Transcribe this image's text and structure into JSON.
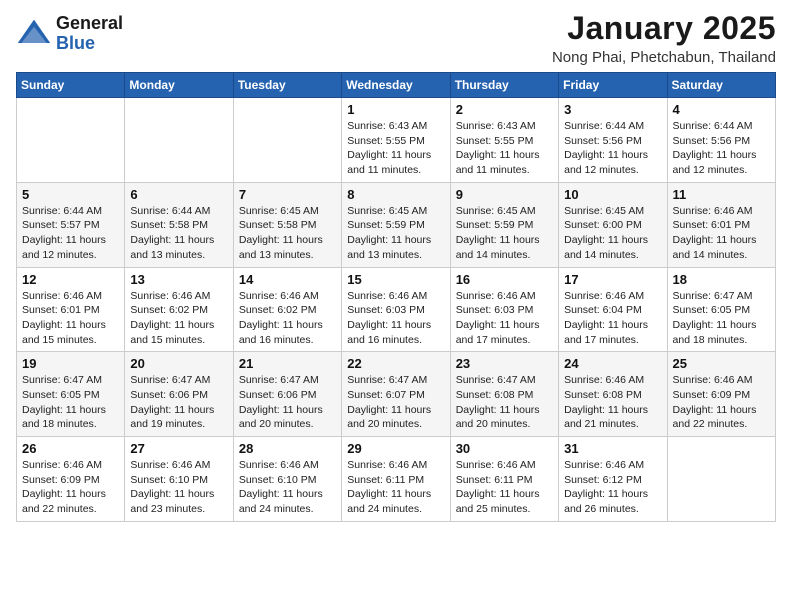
{
  "logo": {
    "general": "General",
    "blue": "Blue"
  },
  "title": "January 2025",
  "subtitle": "Nong Phai, Phetchabun, Thailand",
  "weekdays": [
    "Sunday",
    "Monday",
    "Tuesday",
    "Wednesday",
    "Thursday",
    "Friday",
    "Saturday"
  ],
  "weeks": [
    [
      {
        "day": "",
        "sunrise": "",
        "sunset": "",
        "daylight": ""
      },
      {
        "day": "",
        "sunrise": "",
        "sunset": "",
        "daylight": ""
      },
      {
        "day": "",
        "sunrise": "",
        "sunset": "",
        "daylight": ""
      },
      {
        "day": "1",
        "sunrise": "Sunrise: 6:43 AM",
        "sunset": "Sunset: 5:55 PM",
        "daylight": "Daylight: 11 hours and 11 minutes."
      },
      {
        "day": "2",
        "sunrise": "Sunrise: 6:43 AM",
        "sunset": "Sunset: 5:55 PM",
        "daylight": "Daylight: 11 hours and 11 minutes."
      },
      {
        "day": "3",
        "sunrise": "Sunrise: 6:44 AM",
        "sunset": "Sunset: 5:56 PM",
        "daylight": "Daylight: 11 hours and 12 minutes."
      },
      {
        "day": "4",
        "sunrise": "Sunrise: 6:44 AM",
        "sunset": "Sunset: 5:56 PM",
        "daylight": "Daylight: 11 hours and 12 minutes."
      }
    ],
    [
      {
        "day": "5",
        "sunrise": "Sunrise: 6:44 AM",
        "sunset": "Sunset: 5:57 PM",
        "daylight": "Daylight: 11 hours and 12 minutes."
      },
      {
        "day": "6",
        "sunrise": "Sunrise: 6:44 AM",
        "sunset": "Sunset: 5:58 PM",
        "daylight": "Daylight: 11 hours and 13 minutes."
      },
      {
        "day": "7",
        "sunrise": "Sunrise: 6:45 AM",
        "sunset": "Sunset: 5:58 PM",
        "daylight": "Daylight: 11 hours and 13 minutes."
      },
      {
        "day": "8",
        "sunrise": "Sunrise: 6:45 AM",
        "sunset": "Sunset: 5:59 PM",
        "daylight": "Daylight: 11 hours and 13 minutes."
      },
      {
        "day": "9",
        "sunrise": "Sunrise: 6:45 AM",
        "sunset": "Sunset: 5:59 PM",
        "daylight": "Daylight: 11 hours and 14 minutes."
      },
      {
        "day": "10",
        "sunrise": "Sunrise: 6:45 AM",
        "sunset": "Sunset: 6:00 PM",
        "daylight": "Daylight: 11 hours and 14 minutes."
      },
      {
        "day": "11",
        "sunrise": "Sunrise: 6:46 AM",
        "sunset": "Sunset: 6:01 PM",
        "daylight": "Daylight: 11 hours and 14 minutes."
      }
    ],
    [
      {
        "day": "12",
        "sunrise": "Sunrise: 6:46 AM",
        "sunset": "Sunset: 6:01 PM",
        "daylight": "Daylight: 11 hours and 15 minutes."
      },
      {
        "day": "13",
        "sunrise": "Sunrise: 6:46 AM",
        "sunset": "Sunset: 6:02 PM",
        "daylight": "Daylight: 11 hours and 15 minutes."
      },
      {
        "day": "14",
        "sunrise": "Sunrise: 6:46 AM",
        "sunset": "Sunset: 6:02 PM",
        "daylight": "Daylight: 11 hours and 16 minutes."
      },
      {
        "day": "15",
        "sunrise": "Sunrise: 6:46 AM",
        "sunset": "Sunset: 6:03 PM",
        "daylight": "Daylight: 11 hours and 16 minutes."
      },
      {
        "day": "16",
        "sunrise": "Sunrise: 6:46 AM",
        "sunset": "Sunset: 6:03 PM",
        "daylight": "Daylight: 11 hours and 17 minutes."
      },
      {
        "day": "17",
        "sunrise": "Sunrise: 6:46 AM",
        "sunset": "Sunset: 6:04 PM",
        "daylight": "Daylight: 11 hours and 17 minutes."
      },
      {
        "day": "18",
        "sunrise": "Sunrise: 6:47 AM",
        "sunset": "Sunset: 6:05 PM",
        "daylight": "Daylight: 11 hours and 18 minutes."
      }
    ],
    [
      {
        "day": "19",
        "sunrise": "Sunrise: 6:47 AM",
        "sunset": "Sunset: 6:05 PM",
        "daylight": "Daylight: 11 hours and 18 minutes."
      },
      {
        "day": "20",
        "sunrise": "Sunrise: 6:47 AM",
        "sunset": "Sunset: 6:06 PM",
        "daylight": "Daylight: 11 hours and 19 minutes."
      },
      {
        "day": "21",
        "sunrise": "Sunrise: 6:47 AM",
        "sunset": "Sunset: 6:06 PM",
        "daylight": "Daylight: 11 hours and 20 minutes."
      },
      {
        "day": "22",
        "sunrise": "Sunrise: 6:47 AM",
        "sunset": "Sunset: 6:07 PM",
        "daylight": "Daylight: 11 hours and 20 minutes."
      },
      {
        "day": "23",
        "sunrise": "Sunrise: 6:47 AM",
        "sunset": "Sunset: 6:08 PM",
        "daylight": "Daylight: 11 hours and 20 minutes."
      },
      {
        "day": "24",
        "sunrise": "Sunrise: 6:46 AM",
        "sunset": "Sunset: 6:08 PM",
        "daylight": "Daylight: 11 hours and 21 minutes."
      },
      {
        "day": "25",
        "sunrise": "Sunrise: 6:46 AM",
        "sunset": "Sunset: 6:09 PM",
        "daylight": "Daylight: 11 hours and 22 minutes."
      }
    ],
    [
      {
        "day": "26",
        "sunrise": "Sunrise: 6:46 AM",
        "sunset": "Sunset: 6:09 PM",
        "daylight": "Daylight: 11 hours and 22 minutes."
      },
      {
        "day": "27",
        "sunrise": "Sunrise: 6:46 AM",
        "sunset": "Sunset: 6:10 PM",
        "daylight": "Daylight: 11 hours and 23 minutes."
      },
      {
        "day": "28",
        "sunrise": "Sunrise: 6:46 AM",
        "sunset": "Sunset: 6:10 PM",
        "daylight": "Daylight: 11 hours and 24 minutes."
      },
      {
        "day": "29",
        "sunrise": "Sunrise: 6:46 AM",
        "sunset": "Sunset: 6:11 PM",
        "daylight": "Daylight: 11 hours and 24 minutes."
      },
      {
        "day": "30",
        "sunrise": "Sunrise: 6:46 AM",
        "sunset": "Sunset: 6:11 PM",
        "daylight": "Daylight: 11 hours and 25 minutes."
      },
      {
        "day": "31",
        "sunrise": "Sunrise: 6:46 AM",
        "sunset": "Sunset: 6:12 PM",
        "daylight": "Daylight: 11 hours and 26 minutes."
      },
      {
        "day": "",
        "sunrise": "",
        "sunset": "",
        "daylight": ""
      }
    ]
  ]
}
